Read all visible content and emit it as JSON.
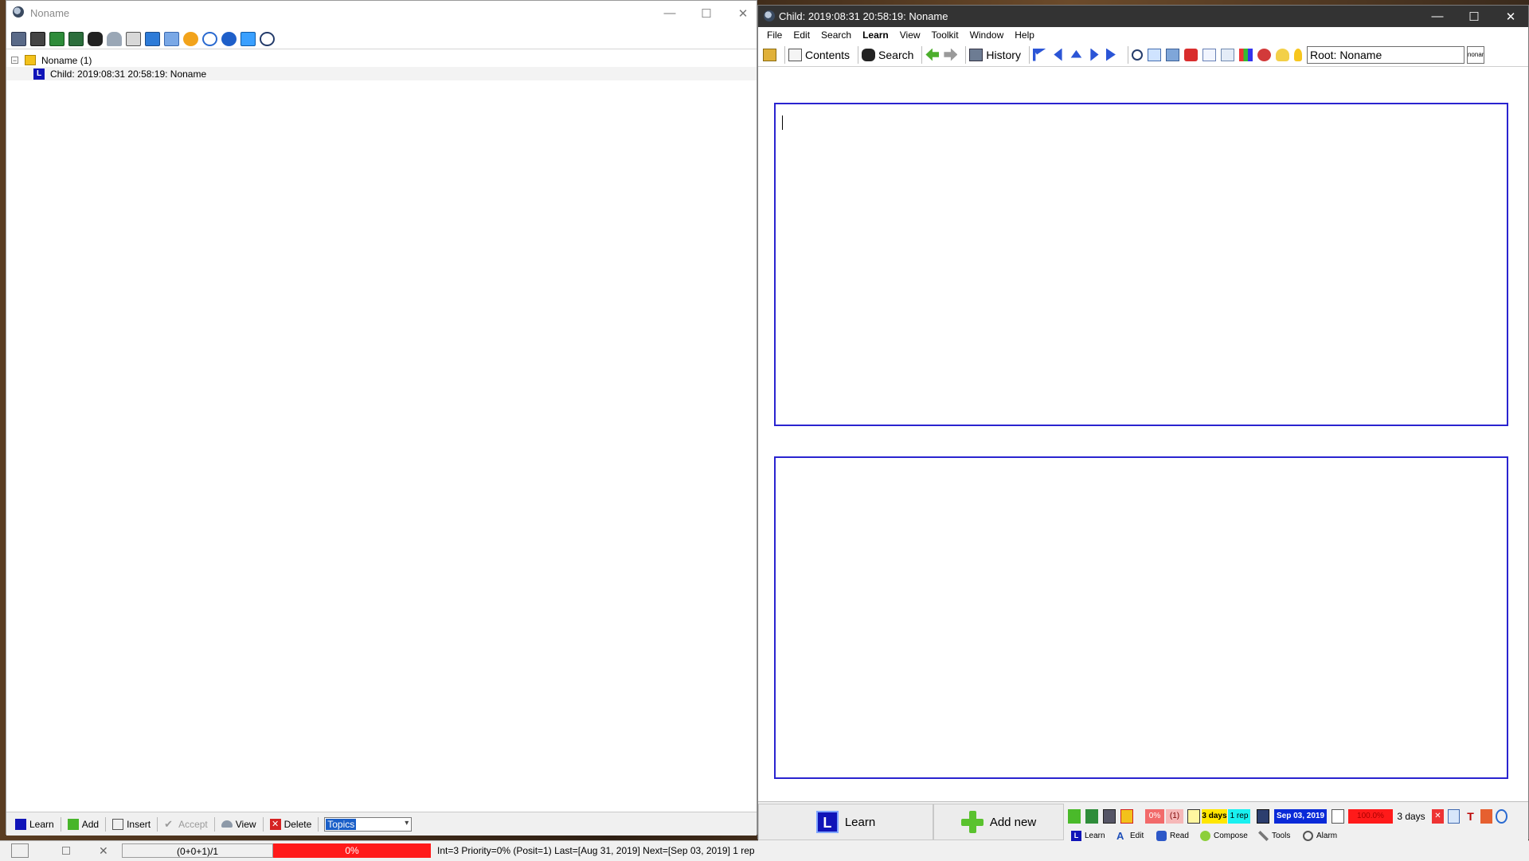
{
  "left_window": {
    "title": "Noname",
    "tree": [
      {
        "label": "Noname (1)",
        "icon": "folder-icon"
      },
      {
        "label": "Child: 2019:08:31 20:58:19: Noname",
        "badge": "L"
      }
    ],
    "bottom_buttons": {
      "learn": "Learn",
      "add": "Add",
      "insert": "Insert",
      "accept": "Accept",
      "view": "View",
      "delete": "Delete"
    },
    "topics_value": "Topics"
  },
  "status": {
    "count": "(0+0+1)/1",
    "percent": "0%",
    "info": "Int=3 Priority=0% (Posit=1) Last=[Aug 31, 2019] Next=[Sep 03, 2019] 1 rep"
  },
  "right_window": {
    "title": "Child: 2019:08:31 20:58:19: Noname",
    "menu": [
      "File",
      "Edit",
      "Search",
      "Learn",
      "View",
      "Toolkit",
      "Window",
      "Help"
    ],
    "toolbar": {
      "contents": "Contents",
      "search": "Search",
      "history": "History",
      "root_value": "Root: Noname",
      "small_value": "nonam"
    },
    "bottom": {
      "learn": "Learn",
      "add_new": "Add new",
      "indicators": {
        "percent": "0%",
        "count": "(1)",
        "days": "3 days",
        "rep": "1 rep",
        "date": "Sep 03, 2019",
        "pct100": "100.0%",
        "interval": "3 days"
      },
      "subbar": {
        "learn": "Learn",
        "edit": "Edit",
        "read": "Read",
        "compose": "Compose",
        "tools": "Tools",
        "alarm": "Alarm"
      }
    }
  },
  "colors": {
    "accent_blue": "#1014b8",
    "panel_border": "#2a24d0",
    "status_red": "#ff1a1a",
    "title_dark": "#333333"
  }
}
